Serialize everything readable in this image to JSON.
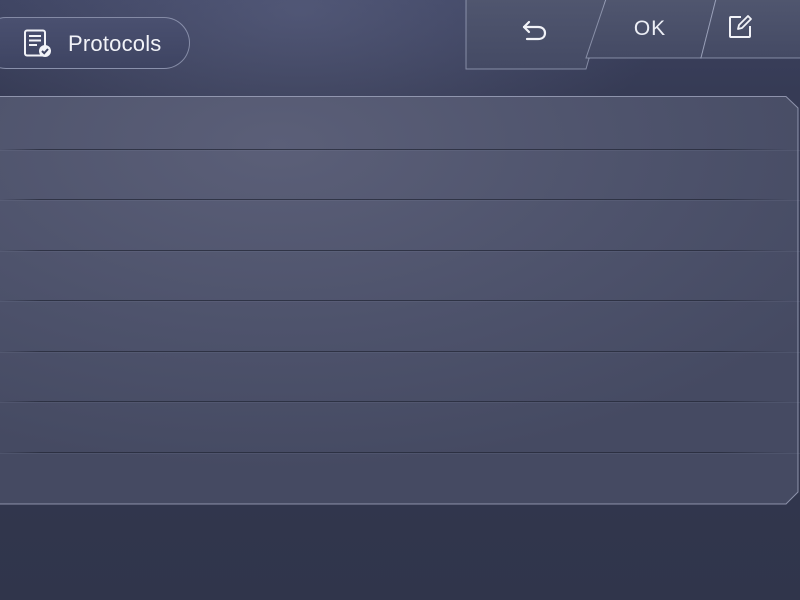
{
  "header": {
    "title": "Protocols",
    "title_icon": "protocol-document-check-icon"
  },
  "toolbar": {
    "back_icon": "undo-arrow-icon",
    "ok_label": "OK",
    "edit_icon": "edit-pencil-icon"
  },
  "protocol_list": {
    "rows": [
      "",
      "",
      "",
      "",
      "",
      "",
      "",
      ""
    ]
  },
  "colors": {
    "background": "#30354b",
    "panel": "#4e536c",
    "border": "#a8adc6",
    "text": "#f2f3f8"
  }
}
